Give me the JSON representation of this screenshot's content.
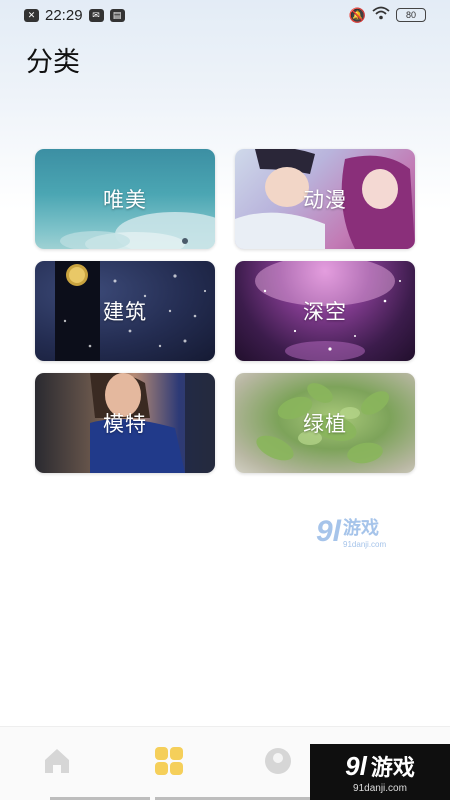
{
  "status_bar": {
    "time": "22:29",
    "battery": "80"
  },
  "page": {
    "title": "分类"
  },
  "categories": [
    {
      "label": "唯美"
    },
    {
      "label": "动漫"
    },
    {
      "label": "建筑"
    },
    {
      "label": "深空"
    },
    {
      "label": "模特"
    },
    {
      "label": "绿植"
    }
  ],
  "watermark": {
    "num": "9l",
    "brand": "游戏",
    "url": "91danji.com"
  },
  "bottom_nav": {
    "items": [
      {
        "icon": "home-icon"
      },
      {
        "icon": "category-grid-icon",
        "active_color": "#f5cf5a"
      },
      {
        "icon": "mine-icon"
      }
    ]
  },
  "corner_badge": {
    "num": "9l",
    "brand": "游戏",
    "url": "91danji.com"
  }
}
